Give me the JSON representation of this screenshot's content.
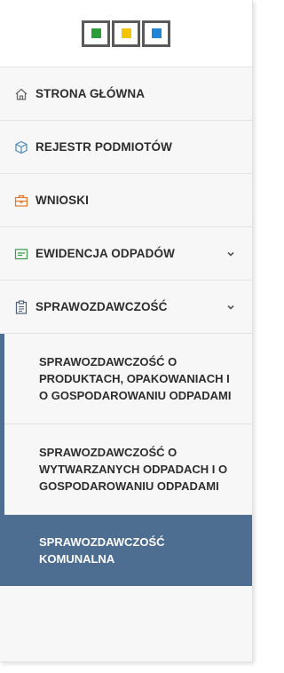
{
  "brand": {
    "logo_colors": [
      "#2a9d3a",
      "#f2c500",
      "#1f86d6"
    ]
  },
  "menu": [
    {
      "label": "STRONA GŁÓWNA",
      "icon": "home-icon",
      "icon_color": "#6b6b6b"
    },
    {
      "label": "REJESTR PODMIOTÓW",
      "icon": "cube-icon",
      "icon_color": "#4a8ab5"
    },
    {
      "label": "WNIOSKI",
      "icon": "briefcase-icon",
      "icon_color": "#e07a2e"
    },
    {
      "label": "EWIDENCJA ODPADÓW",
      "icon": "card-icon",
      "icon_color": "#3a9a4a",
      "expandable": true
    },
    {
      "label": "SPRAWOZDAWCZOŚĆ",
      "icon": "clipboard-icon",
      "icon_color": "#4f5e78",
      "expandable": true,
      "expanded": true
    }
  ],
  "submenu": [
    {
      "label": "SPRAWOZDAWCZOŚĆ O PRODUKTACH, OPAKOWANIACH I O GOSPODAROWANIU ODPADAMI",
      "active": false
    },
    {
      "label": "SPRAWOZDAWCZOŚĆ O WYTWARZANYCH ODPADACH I O GOSPODAROWANIU ODPADAMI",
      "active": false
    },
    {
      "label": "SPRAWOZDAWCZOŚĆ KOMUNALNA",
      "active": true
    }
  ],
  "colors": {
    "active_bg": "#4d6d91",
    "active_text": "#ffffff"
  }
}
